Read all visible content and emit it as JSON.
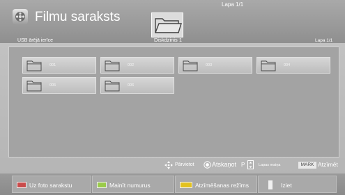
{
  "header": {
    "title": "Filmu saraksts",
    "page_indicator": "Lapa 1/1",
    "device_label": "USB ārējā ierīce",
    "drive_label": "Diskdzinis 1",
    "page_indicator_small": "Lapa 1/1"
  },
  "folders": [
    {
      "name": "001"
    },
    {
      "name": "002"
    },
    {
      "name": "003"
    },
    {
      "name": "004"
    },
    {
      "name": "005"
    },
    {
      "name": "006"
    }
  ],
  "actions": {
    "move": "Pārvietot",
    "play": "Atskaņot",
    "page_key": "P",
    "page_change": "Lapas maiņa",
    "mark_key": "MARK",
    "mark": "Atzīmēt"
  },
  "bottom_buttons": [
    {
      "label": "Uz foto sarakstu",
      "key_color": "#c94b4b"
    },
    {
      "label": "Mainīt numurus",
      "key_color": "#9acb4a"
    },
    {
      "label": "Atzīmēšanas režīms",
      "key_color": "#e3c21f"
    },
    {
      "label": "Iziet",
      "key_color": "#4a6fd1"
    }
  ],
  "icons": {
    "app": "film-reel-icon",
    "drive": "folder-icon",
    "move": "four-way-arrow-icon",
    "play": "ok-button-icon",
    "page": "page-up-down-icon",
    "exit": "exit-door-icon"
  }
}
